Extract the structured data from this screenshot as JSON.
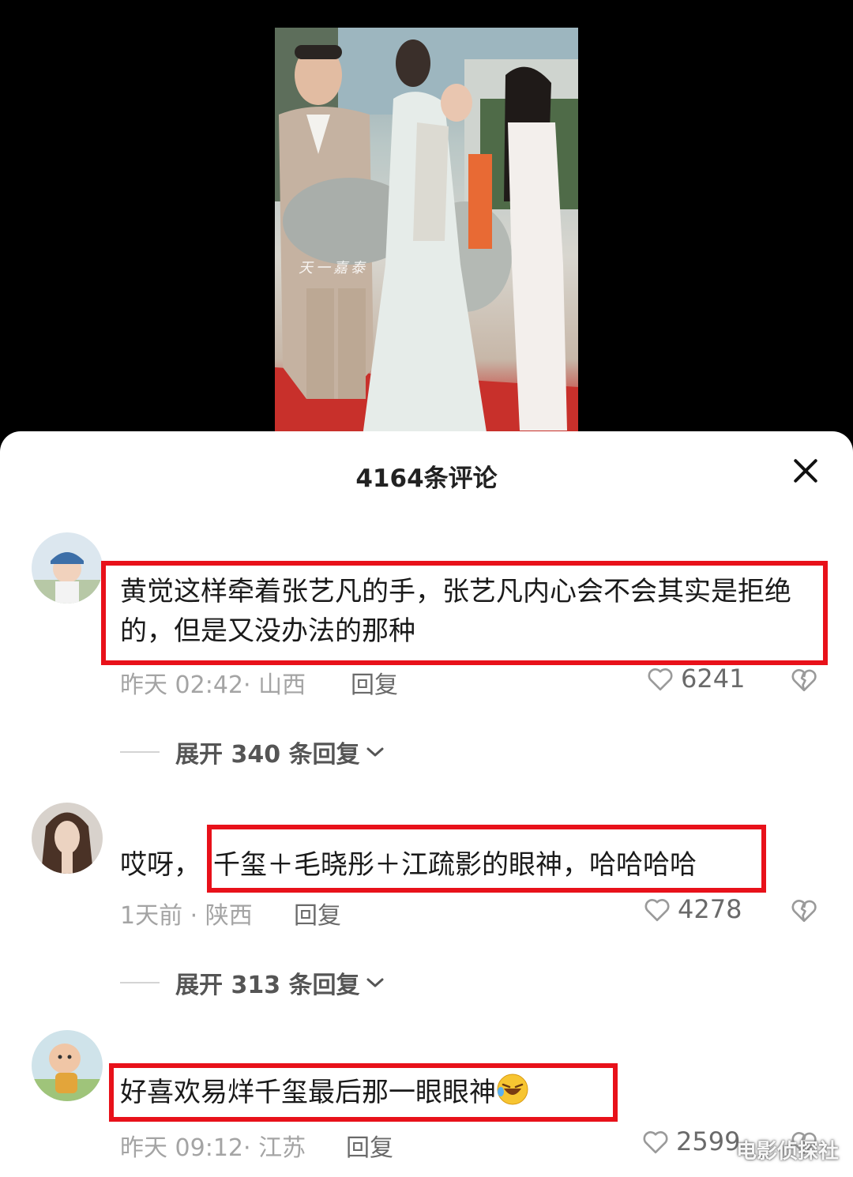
{
  "video": {
    "overlay_text": "天一嘉泰"
  },
  "sheet": {
    "title": "4164条评论",
    "close_icon": "close-icon"
  },
  "comments": [
    {
      "text": "黄觉这样牵着张艺凡的手，张艺凡内心会不会其实是拒绝的，但是又没办法的那种",
      "time_location": "昨天 02:42· 山西",
      "reply_label": "回复",
      "likes": "6241",
      "expand_label": "展开 340 条回复"
    },
    {
      "text_prefix": "哎呀，",
      "text": "千玺＋毛晓彤＋江疏影的眼神，哈哈哈哈",
      "time_location": "1天前 · 陕西",
      "reply_label": "回复",
      "likes": "4278",
      "expand_label": "展开 313 条回复"
    },
    {
      "text": "好喜欢易烊千玺最后那一眼眼神",
      "emoji": "rolling-on-floor-laughing",
      "time_location": "昨天 09:12· 江苏",
      "reply_label": "回复",
      "likes": "259",
      "likes_suffix": "9"
    }
  ],
  "watermark": "电影侦探社",
  "colors": {
    "highlight_box": "#e8111a",
    "meta_gray": "#a4a4a4",
    "sheet_bg": "#ffffff",
    "backdrop": "#000000"
  }
}
